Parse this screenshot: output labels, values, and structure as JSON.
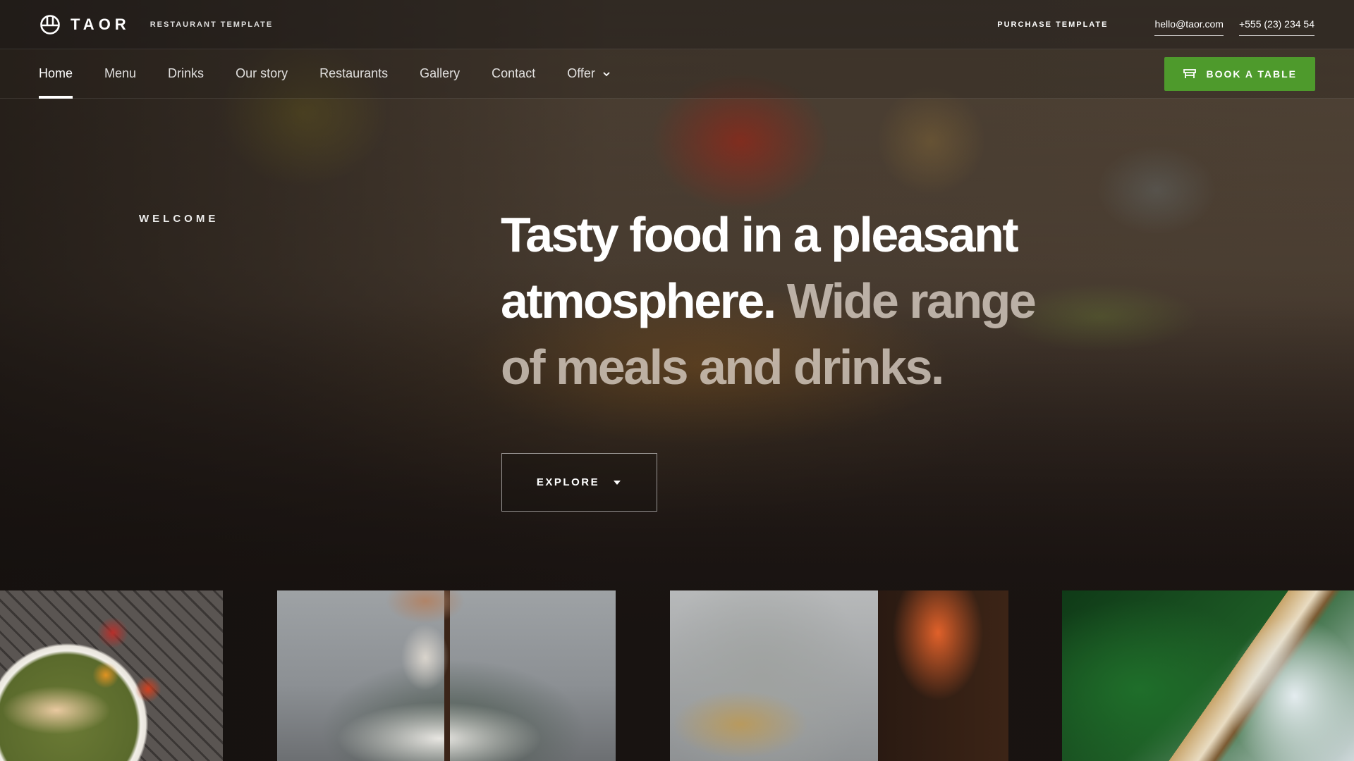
{
  "brand": {
    "name": "TAOR",
    "tagline": "RESTAURANT TEMPLATE",
    "logo_icon": "globe-logo-icon"
  },
  "topbar": {
    "purchase_label": "PURCHASE TEMPLATE",
    "email": "hello@taor.com",
    "phone": "+555 (23) 234 54"
  },
  "nav": {
    "items": [
      {
        "label": "Home",
        "active": true
      },
      {
        "label": "Menu"
      },
      {
        "label": "Drinks"
      },
      {
        "label": "Our story"
      },
      {
        "label": "Restaurants"
      },
      {
        "label": "Gallery"
      },
      {
        "label": "Contact"
      },
      {
        "label": "Offer",
        "icon": "chevron-down-icon"
      }
    ],
    "book_label": "BOOK A TABLE",
    "book_icon": "table-icon"
  },
  "hero": {
    "eyebrow": "WELCOME",
    "headline_bright": "Tasty food in a pleasant atmosphere.",
    "headline_muted": "Wide range of meals and drinks.",
    "explore_label": "EXPLORE"
  },
  "colors": {
    "accent_green": "#4e9a2c",
    "background": "#1a1412"
  }
}
